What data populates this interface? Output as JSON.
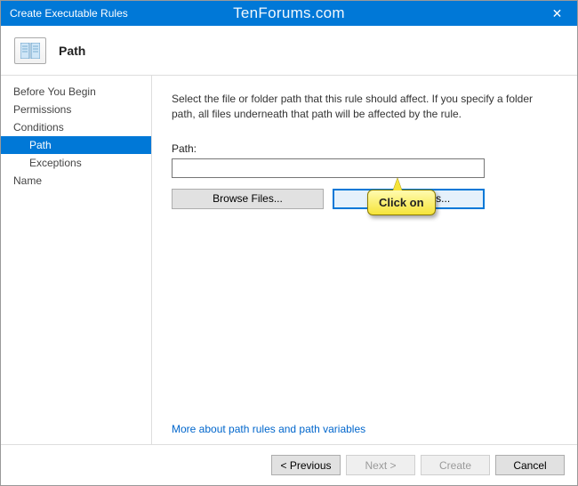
{
  "window": {
    "title": "Create Executable Rules",
    "watermark": "TenForums.com"
  },
  "header": {
    "title": "Path"
  },
  "sidebar": {
    "items": [
      {
        "label": "Before You Begin",
        "selected": false,
        "sub": false
      },
      {
        "label": "Permissions",
        "selected": false,
        "sub": false
      },
      {
        "label": "Conditions",
        "selected": false,
        "sub": false
      },
      {
        "label": "Path",
        "selected": true,
        "sub": true
      },
      {
        "label": "Exceptions",
        "selected": false,
        "sub": true
      },
      {
        "label": "Name",
        "selected": false,
        "sub": false
      }
    ]
  },
  "content": {
    "instruction": "Select the file or folder path that this rule should affect. If you specify a folder path, all files underneath that path will be affected by the rule.",
    "path_label": "Path:",
    "path_value": "",
    "browse_files": "Browse Files...",
    "browse_folders": "Browse Folders...",
    "more_link": "More about path rules and path variables"
  },
  "callout": {
    "text": "Click on"
  },
  "footer": {
    "previous": "< Previous",
    "next": "Next >",
    "create": "Create",
    "cancel": "Cancel"
  }
}
